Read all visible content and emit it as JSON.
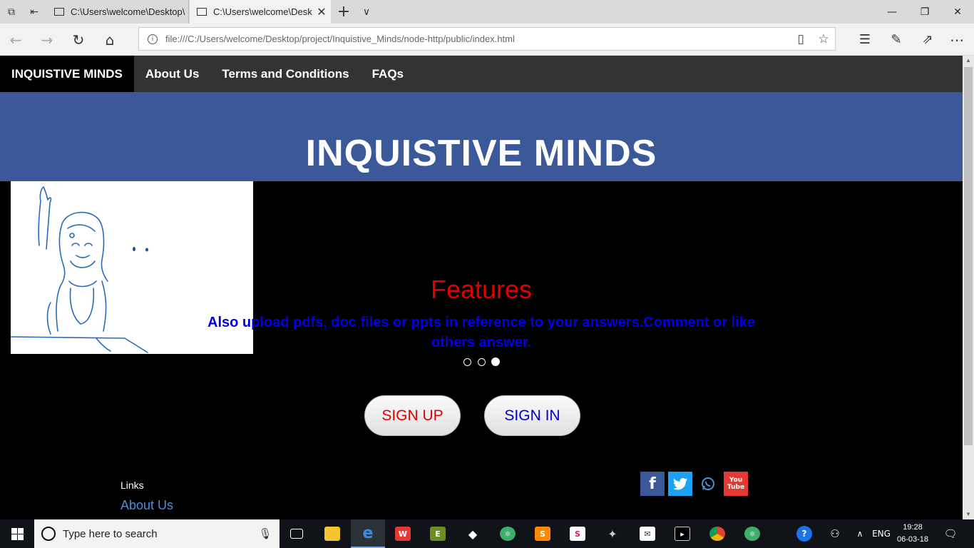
{
  "browser": {
    "tabs": [
      {
        "title": "C:\\Users\\welcome\\Desktop\\",
        "active": false
      },
      {
        "title": "C:\\Users\\welcome\\Desk",
        "active": true
      }
    ],
    "new_tab": "+",
    "tab_list": "∨",
    "url": "file:///C:/Users/welcome/Desktop/project/Inquistive_Minds/node-http/public/index.html",
    "window_buttons": {
      "minimize": "—",
      "maximize": "❐",
      "close": "✕"
    }
  },
  "page": {
    "nav": {
      "brand": "INQUISTIVE MINDS",
      "items": [
        "About Us",
        "Terms and Conditions",
        "FAQs"
      ]
    },
    "hero_title": "INQUISTIVE MINDS",
    "carousel": {
      "title": "Features",
      "text": "Also upload pdfs, doc files or ppts in reference to your answers.Comment or like others answer.",
      "slide_count": 3,
      "active_slide": 3
    },
    "buttons": {
      "signup": "SIGN UP",
      "signin": "SIGN IN"
    },
    "footer": {
      "links_heading": "Links",
      "links": [
        "About Us"
      ],
      "social": [
        "facebook-icon",
        "twitter-icon",
        "whatsapp-icon",
        "youtube-icon"
      ],
      "youtube_label": "You Tube"
    }
  },
  "taskbar": {
    "search_placeholder": "Type here to search",
    "language": "ENG",
    "time": "19:28",
    "date": "06-03-18",
    "apps": [
      "task-view-icon",
      "file-explorer-icon",
      "edge-icon",
      "wps-office-icon",
      "evernote-icon",
      "dropbox-icon",
      "atom-icon",
      "sublime-icon",
      "slack-icon",
      "unity-icon",
      "mail-icon",
      "terminal-icon",
      "chrome-icon",
      "atom-icon"
    ]
  },
  "colors": {
    "nav_bg": "#333333",
    "hero_bg": "#3b5998",
    "features_title": "#e00000",
    "features_text": "#0000e0",
    "signup_text": "#e00000",
    "signin_text": "#0000c8",
    "link": "#4a90d9"
  }
}
